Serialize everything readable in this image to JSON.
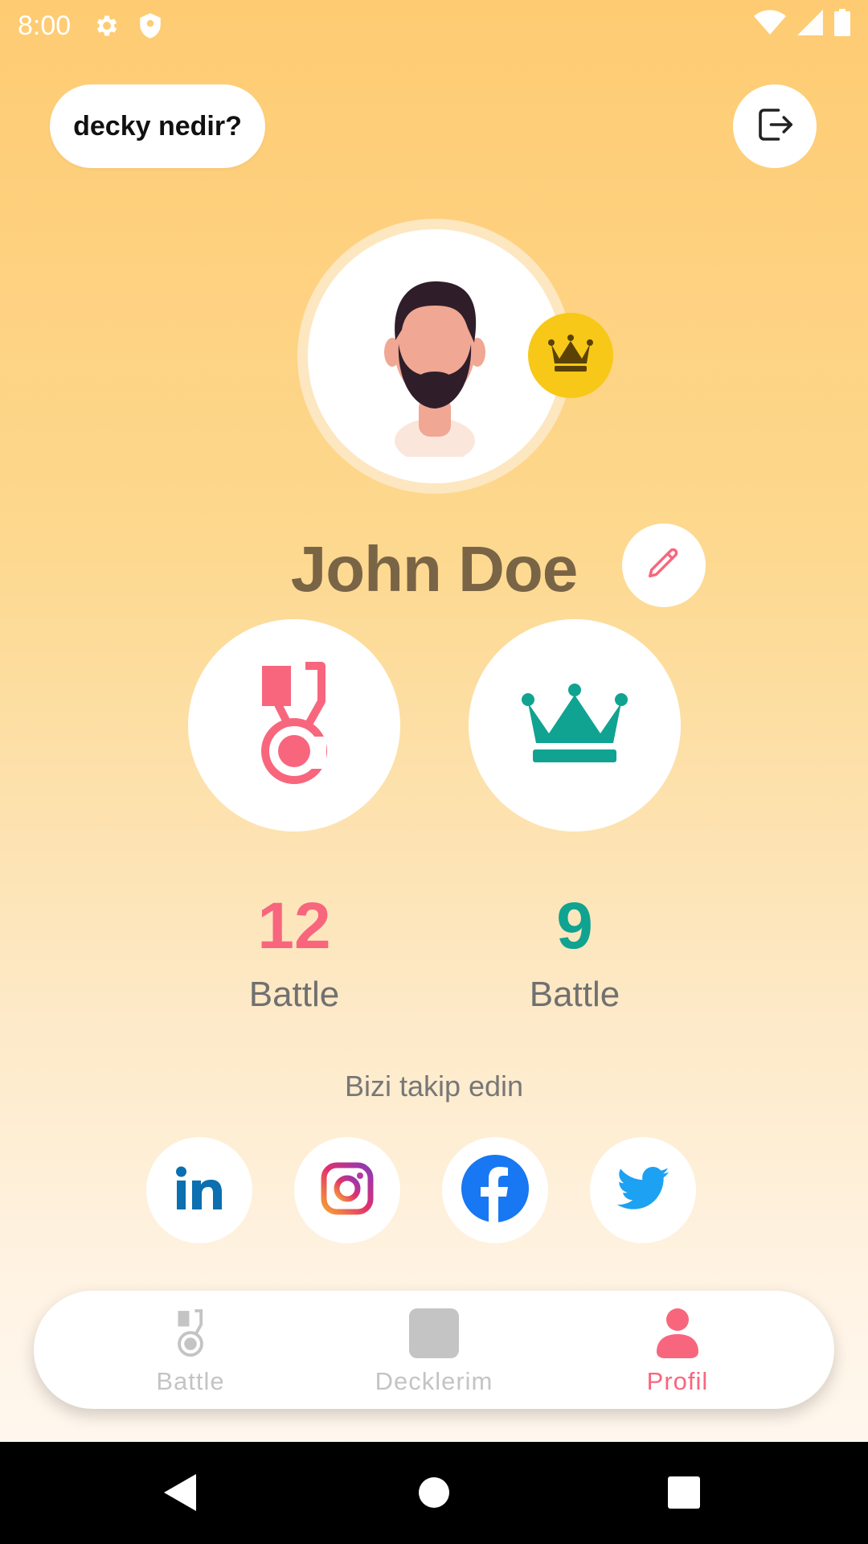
{
  "status_bar": {
    "time": "8:00",
    "icons_left": [
      "gear-icon",
      "shield-icon"
    ],
    "icons_right": [
      "wifi-icon",
      "signal-icon",
      "battery-icon"
    ]
  },
  "header": {
    "info_button_label": "decky nedir?",
    "logout_icon": "logout-icon"
  },
  "profile": {
    "name": "John Doe",
    "badge_icon": "crown-icon",
    "edit_icon": "pencil-icon"
  },
  "stats": [
    {
      "icon": "medal-icon",
      "value": "12",
      "label": "Battle",
      "color": "#f8667e"
    },
    {
      "icon": "crown-icon",
      "value": "9",
      "label": "Battle",
      "color": "#10a391"
    }
  ],
  "social": {
    "title": "Bizi takip edin",
    "links": [
      "linkedin-icon",
      "instagram-icon",
      "facebook-icon",
      "twitter-icon"
    ]
  },
  "bottom_nav": {
    "items": [
      {
        "label": "Battle",
        "icon": "medal-icon",
        "active": false
      },
      {
        "label": "Decklerim",
        "icon": "deck-icon",
        "active": false
      },
      {
        "label": "Profil",
        "icon": "person-icon",
        "active": true
      }
    ]
  },
  "colors": {
    "accent_pink": "#f8667e",
    "accent_teal": "#10a391",
    "crown_yellow": "#f7c817",
    "name_brown": "#7a6446",
    "background_top": "#fecb72"
  }
}
